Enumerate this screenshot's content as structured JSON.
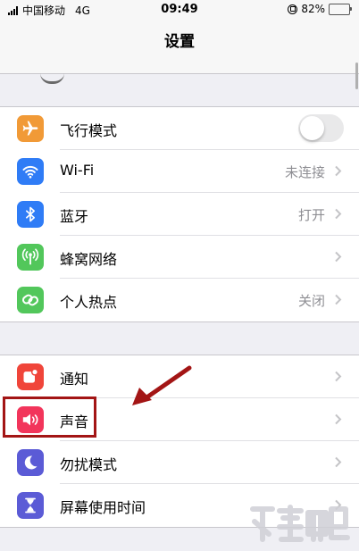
{
  "status_bar": {
    "carrier": "中国移动",
    "network": "4G",
    "time": "09:49",
    "battery_percent": "82%",
    "battery_level": 0.82
  },
  "nav": {
    "title": "设置"
  },
  "groups": [
    {
      "rows": [
        {
          "name": "airplane-mode",
          "label": "飞行模式",
          "value": "",
          "control": "toggle",
          "toggle_on": false,
          "icon": "airplane-icon",
          "color": "#f19a37"
        },
        {
          "name": "wifi",
          "label": "Wi-Fi",
          "value": "未连接",
          "control": "chevron",
          "icon": "wifi-icon",
          "color": "#2f7cf6"
        },
        {
          "name": "bluetooth",
          "label": "蓝牙",
          "value": "打开",
          "control": "chevron",
          "icon": "bluetooth-icon",
          "color": "#2f7cf6"
        },
        {
          "name": "cellular",
          "label": "蜂窝网络",
          "value": "",
          "control": "chevron",
          "icon": "cellular-antenna-icon",
          "color": "#52c75b"
        },
        {
          "name": "personal-hotspot",
          "label": "个人热点",
          "value": "关闭",
          "control": "chevron",
          "icon": "hotspot-link-icon",
          "color": "#52c75b"
        }
      ]
    },
    {
      "rows": [
        {
          "name": "notifications",
          "label": "通知",
          "value": "",
          "control": "chevron",
          "icon": "notification-icon",
          "color": "#f0453a"
        },
        {
          "name": "sounds",
          "label": "声音",
          "value": "",
          "control": "chevron",
          "icon": "speaker-icon",
          "color": "#f2355b"
        },
        {
          "name": "do-not-disturb",
          "label": "勿扰模式",
          "value": "",
          "control": "chevron",
          "icon": "moon-icon",
          "color": "#5b5bd6"
        },
        {
          "name": "screen-time",
          "label": "屏幕使用时间",
          "value": "",
          "control": "chevron",
          "icon": "hourglass-icon",
          "color": "#5b5bd6"
        }
      ]
    }
  ],
  "annotation": {
    "color": "#a31515"
  }
}
